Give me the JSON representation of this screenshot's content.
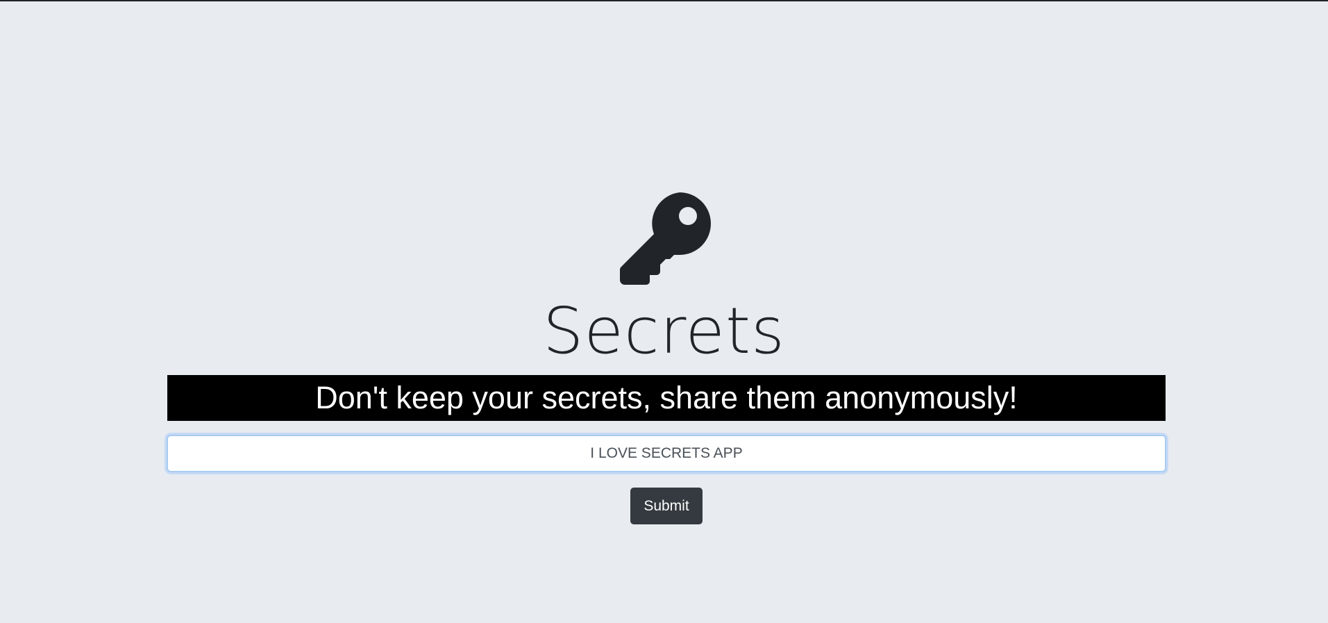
{
  "hero": {
    "icon": "key-icon",
    "title": "Secrets",
    "tagline": "Don't keep your secrets, share them anonymously!"
  },
  "form": {
    "secret_value": "I LOVE SECRETS APP",
    "submit_label": "Submit"
  },
  "colors": {
    "background": "#e8ecf0",
    "text": "#212529",
    "tagline_bg": "#000000",
    "button_bg": "#343a40",
    "focus_ring": "#86b7fe"
  }
}
